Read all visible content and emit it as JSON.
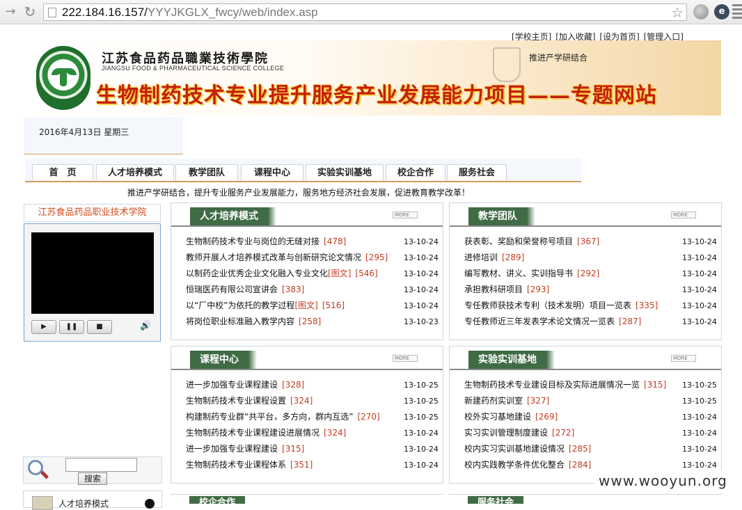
{
  "browser": {
    "url_host": "222.184.16.157/",
    "url_path": "YYYJKGLX_fwcy/web/index.asp"
  },
  "top_links": [
    "[学校主页]",
    "[加入收藏]",
    "[设为首页]",
    "[管理入口]"
  ],
  "banner": {
    "college_cn": "江苏食品药品職業技術學院",
    "college_en": "JIANGSU FOOD & PHARMACEUTICAL SCIENCE COLLEGE",
    "slogan": "推进产学研结合",
    "title": "生物制药技术专业提升服务产业发展能力项目——专题网站"
  },
  "date": "2016年4月13日 星期三",
  "nav": [
    "首　页",
    "人才培养模式",
    "教学团队",
    "课程中心",
    "实验实训基地",
    "校企合作",
    "服务社会"
  ],
  "marquee": "推进产学研结合，提升专业服务产业发展能力，服务地方经济社会发展，促进教育教学改革！",
  "left": {
    "title": "江苏食品药品职业技术学院",
    "search_button": "搜索",
    "next_section": "人才培养模式"
  },
  "panels": [
    {
      "title": "人才培养模式",
      "rows": [
        {
          "text": "生物制药技术专业与岗位的无缝对接",
          "pic": "",
          "count": "[478]",
          "date": "13-10-24"
        },
        {
          "text": "教师开展人才培养模式改革与创新研究论文情况",
          "pic": "",
          "count": "[295]",
          "date": "13-10-24"
        },
        {
          "text": "以制药企业优秀企业文化融入专业文化",
          "pic": "[图文]",
          "count": "[546]",
          "date": "13-10-24"
        },
        {
          "text": "恒瑞医药有限公司宣讲会",
          "pic": "",
          "count": "[383]",
          "date": "13-10-24"
        },
        {
          "text": "以“厂中校”为依托的教学过程",
          "pic": "[图文]",
          "count": "[516]",
          "date": "13-10-24"
        },
        {
          "text": "将岗位职业标准融入教学内容",
          "pic": "",
          "count": "[258]",
          "date": "13-10-23"
        }
      ]
    },
    {
      "title": "教学团队",
      "rows": [
        {
          "text": "获表彰、奖励和荣誉称号项目",
          "pic": "",
          "count": "[367]",
          "date": "13-10-24"
        },
        {
          "text": "进修培训",
          "pic": "",
          "count": "[289]",
          "date": "13-10-24"
        },
        {
          "text": "编写教材、讲义、实训指导书",
          "pic": "",
          "count": "[292]",
          "date": "13-10-24"
        },
        {
          "text": "承担教科研项目",
          "pic": "",
          "count": "[293]",
          "date": "13-10-24"
        },
        {
          "text": "专任教师获技术专利（技术发明）项目一览表",
          "pic": "",
          "count": "[335]",
          "date": "13-10-24"
        },
        {
          "text": "专任教师近三年发表学术论文情况一览表",
          "pic": "",
          "count": "[287]",
          "date": "13-10-24"
        }
      ]
    },
    {
      "title": "课程中心",
      "rows": [
        {
          "text": "进一步加强专业课程建设",
          "pic": "",
          "count": "[328]",
          "date": "13-10-25"
        },
        {
          "text": "生物制药技术专业课程设置",
          "pic": "",
          "count": "[324]",
          "date": "13-10-25"
        },
        {
          "text": "构建制药专业群“共平台，多方向，群内互选”",
          "pic": "",
          "count": "[270]",
          "date": "13-10-25"
        },
        {
          "text": "生物制药技术专业课程建设进展情况",
          "pic": "",
          "count": "[324]",
          "date": "13-10-24"
        },
        {
          "text": "进一步加强专业课程建设",
          "pic": "",
          "count": "[315]",
          "date": "13-10-24"
        },
        {
          "text": "生物制药技术专业课程体系",
          "pic": "",
          "count": "[351]",
          "date": "13-10-24"
        }
      ]
    },
    {
      "title": "实验实训基地",
      "rows": [
        {
          "text": "生物制药技术专业建设目标及实际进展情况一览",
          "pic": "",
          "count": "[315]",
          "date": "13-10-25"
        },
        {
          "text": "新建药剂实训室",
          "pic": "",
          "count": "[327]",
          "date": "13-10-25"
        },
        {
          "text": "校外实习基地建设",
          "pic": "",
          "count": "[269]",
          "date": "13-10-24"
        },
        {
          "text": "实习实训管理制度建设",
          "pic": "",
          "count": "[272]",
          "date": "13-10-24"
        },
        {
          "text": "校内实习实训基地建设情况",
          "pic": "",
          "count": "[285]",
          "date": "13-10-24"
        },
        {
          "text": "校内实践教学条件优化整合",
          "pic": "",
          "count": "[284]",
          "date": "13-10-24"
        }
      ]
    }
  ],
  "more_label": "MORE",
  "bottom_panels": [
    "校企合作",
    "服务社会"
  ],
  "watermark": "www.wooyun.org"
}
